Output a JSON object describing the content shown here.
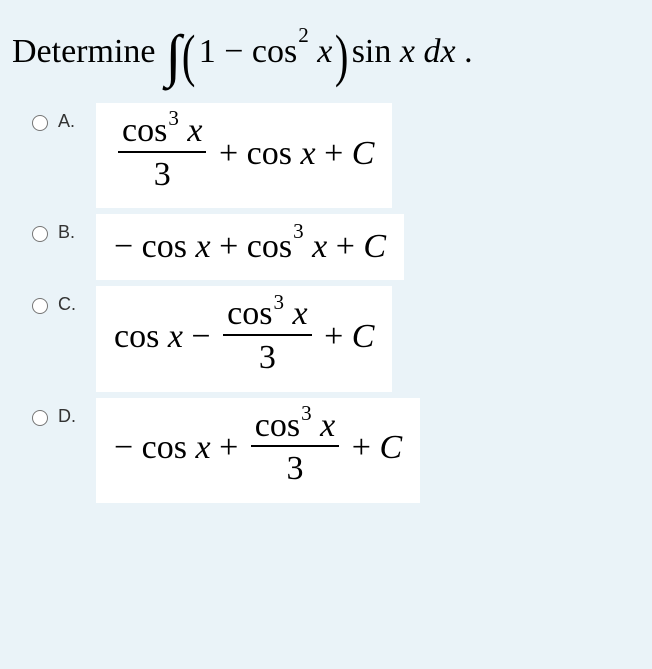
{
  "question": {
    "lead": "Determine",
    "integrand_inside": "1 − cos² x",
    "integrand_tail": "sin x dx",
    "trailing": "."
  },
  "choices": {
    "A": {
      "label": "A.",
      "formula": "cos³x / 3 + cos x + C"
    },
    "B": {
      "label": "B.",
      "formula": "− cos x + cos³ x + C"
    },
    "C": {
      "label": "C.",
      "formula": "cos x − cos³x / 3 + C"
    },
    "D": {
      "label": "D.",
      "formula": "− cos x + cos³x / 3 + C"
    }
  }
}
